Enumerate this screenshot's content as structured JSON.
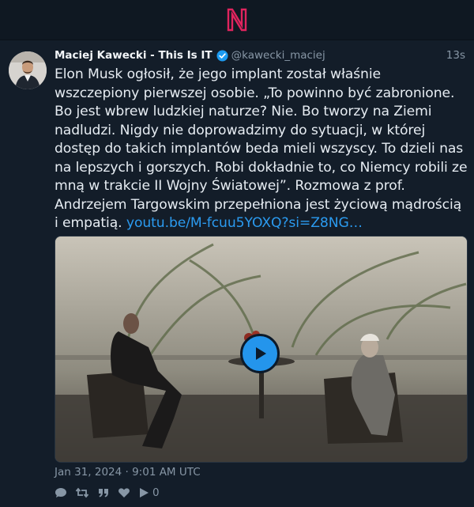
{
  "app": {
    "logo_letter": "N",
    "brand_color": "#e0245e"
  },
  "tweet": {
    "author_name": "Maciej Kawecki - This Is IT",
    "handle": "@kawecki_maciej",
    "time_ago": "13s",
    "verified": true,
    "text": "Elon Musk ogłosił, że jego implant został właśnie wszczepiony pierwszej osobie. „To powinno być zabronione. Bo jest wbrew ludzkiej naturze? Nie. Bo tworzy na Ziemi nadludzi. Nigdy nie doprowadzimy do sytuacji, w której dostęp do takich implantów beda mieli wszyscy. To dzieli nas na lepszych i gorszych. Robi dokładnie to, co Niemcy robili ze mną w trakcie II Wojny Światowej”. Rozmowa z prof. Andrzejem Targowskim przepełniona jest życiową mądrością i empatią. ",
    "link_text": "youtu.be/M-fcuu5YOXQ?si=Z8NG…",
    "date": "Jan 31, 2024 · 9:01 AM UTC",
    "stats": {
      "views": "0"
    }
  },
  "colors": {
    "link": "#2b9bf0",
    "accent_play": "#2495ec",
    "background": "#131d29"
  },
  "icons": [
    "comment-icon",
    "retweet-icon",
    "quote-icon",
    "like-icon",
    "play-icon"
  ]
}
